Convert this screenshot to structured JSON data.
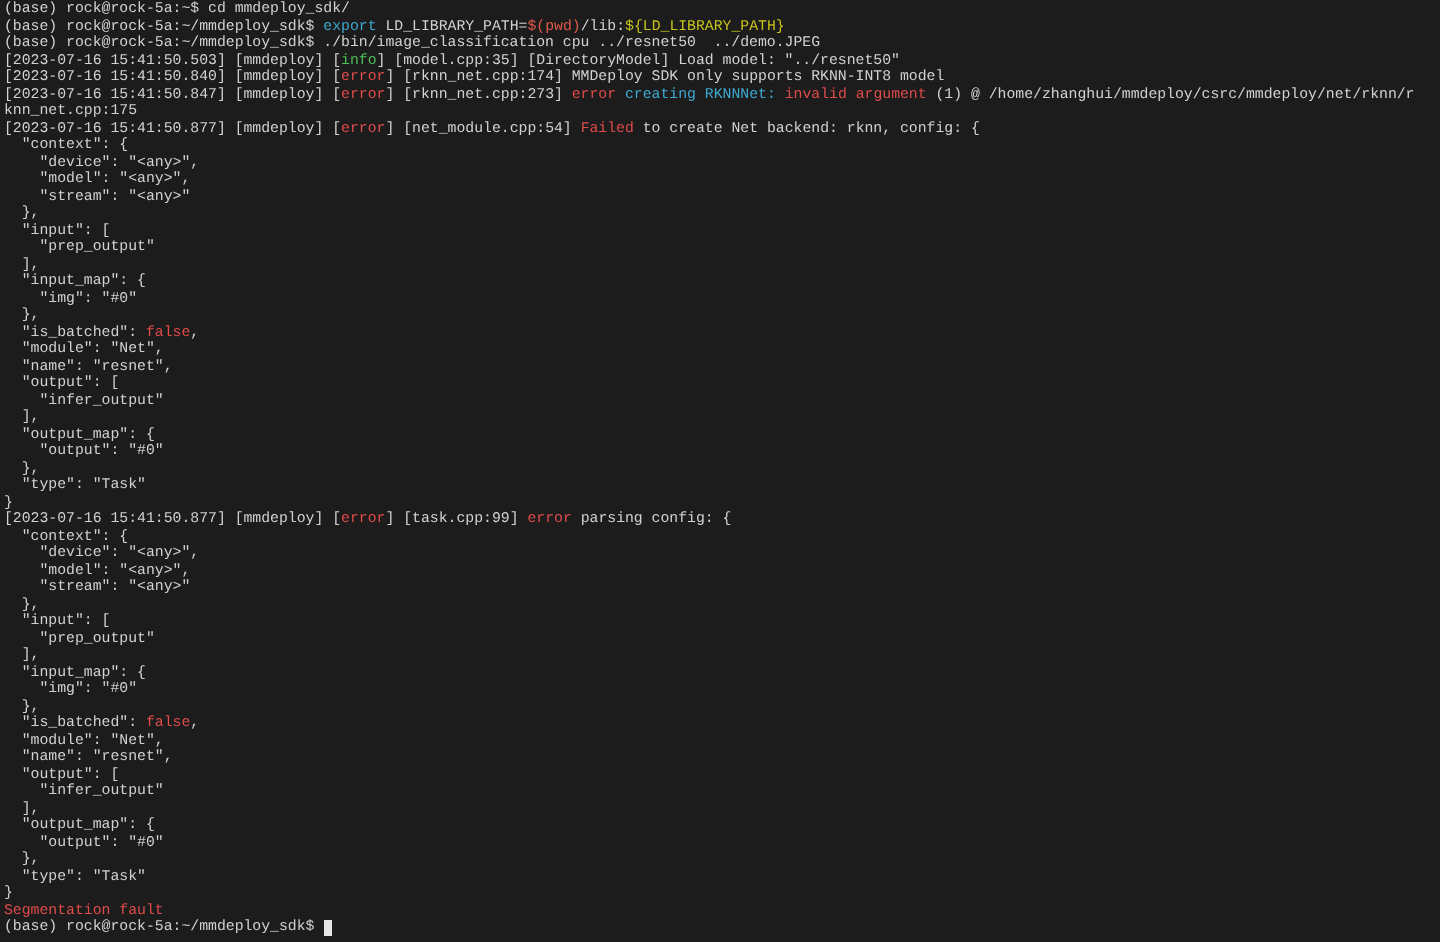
{
  "terminal": {
    "lines": [
      {
        "segments": [
          {
            "kind": "text",
            "text": "(base) rock@rock-5a:~$ cd mmdeploy_sdk/"
          }
        ]
      },
      {
        "segments": [
          {
            "kind": "text",
            "text": "(base) rock@rock-5a:~/mmdeploy_sdk$ "
          },
          {
            "kind": "command",
            "text": "export"
          },
          {
            "kind": "text",
            "text": " LD_LIBRARY_PATH="
          },
          {
            "kind": "substitution",
            "text": "$(pwd)"
          },
          {
            "kind": "text",
            "text": "/lib:"
          },
          {
            "kind": "variable",
            "text": "${LD_LIBRARY_PATH}"
          }
        ]
      },
      {
        "segments": [
          {
            "kind": "text",
            "text": "(base) rock@rock-5a:~/mmdeploy_sdk$ ./bin/image_classification cpu ../resnet50  ../demo.JPEG"
          }
        ]
      },
      {
        "segments": [
          {
            "kind": "text",
            "text": "[2023-07-16 15:41:50.503] [mmdeploy] ["
          },
          {
            "kind": "info",
            "text": "info"
          },
          {
            "kind": "text",
            "text": "] [model.cpp:35] [DirectoryModel] Load model: \"../resnet50\""
          }
        ]
      },
      {
        "segments": [
          {
            "kind": "text",
            "text": "[2023-07-16 15:41:50.840] [mmdeploy] ["
          },
          {
            "kind": "error",
            "text": "error"
          },
          {
            "kind": "text",
            "text": "] [rknn_net.cpp:174] MMDeploy SDK only supports RKNN-INT8 model"
          }
        ]
      },
      {
        "segments": [
          {
            "kind": "text",
            "text": "[2023-07-16 15:41:50.847] [mmdeploy] ["
          },
          {
            "kind": "error",
            "text": "error"
          },
          {
            "kind": "text",
            "text": "] [rknn_net.cpp:273] "
          },
          {
            "kind": "error",
            "text": "error"
          },
          {
            "kind": "command",
            "text": " creating RKNNNet:"
          },
          {
            "kind": "error",
            "text": " invalid argument"
          },
          {
            "kind": "text",
            "text": " (1) @ /home/zhanghui/mmdeploy/csrc/mmdeploy/net/rknn/r"
          }
        ]
      },
      {
        "segments": [
          {
            "kind": "text",
            "text": "knn_net.cpp:175"
          }
        ]
      },
      {
        "segments": [
          {
            "kind": "text",
            "text": "[2023-07-16 15:41:50.877] [mmdeploy] ["
          },
          {
            "kind": "error",
            "text": "error"
          },
          {
            "kind": "text",
            "text": "] [net_module.cpp:54] "
          },
          {
            "kind": "error",
            "text": "Failed"
          },
          {
            "kind": "text",
            "text": " to create Net backend: rknn, config: {"
          }
        ]
      },
      {
        "segments": [
          {
            "kind": "text",
            "text": "  \"context\": {"
          }
        ]
      },
      {
        "segments": [
          {
            "kind": "text",
            "text": "    \"device\": \"<any>\","
          }
        ]
      },
      {
        "segments": [
          {
            "kind": "text",
            "text": "    \"model\": \"<any>\","
          }
        ]
      },
      {
        "segments": [
          {
            "kind": "text",
            "text": "    \"stream\": \"<any>\""
          }
        ]
      },
      {
        "segments": [
          {
            "kind": "text",
            "text": "  },"
          }
        ]
      },
      {
        "segments": [
          {
            "kind": "text",
            "text": "  \"input\": ["
          }
        ]
      },
      {
        "segments": [
          {
            "kind": "text",
            "text": "    \"prep_output\""
          }
        ]
      },
      {
        "segments": [
          {
            "kind": "text",
            "text": "  ],"
          }
        ]
      },
      {
        "segments": [
          {
            "kind": "text",
            "text": "  \"input_map\": {"
          }
        ]
      },
      {
        "segments": [
          {
            "kind": "text",
            "text": "    \"img\": \"#0\""
          }
        ]
      },
      {
        "segments": [
          {
            "kind": "text",
            "text": "  },"
          }
        ]
      },
      {
        "segments": [
          {
            "kind": "text",
            "text": "  \"is_batched\": "
          },
          {
            "kind": "error",
            "text": "false"
          },
          {
            "kind": "text",
            "text": ","
          }
        ]
      },
      {
        "segments": [
          {
            "kind": "text",
            "text": "  \"module\": \"Net\","
          }
        ]
      },
      {
        "segments": [
          {
            "kind": "text",
            "text": "  \"name\": \"resnet\","
          }
        ]
      },
      {
        "segments": [
          {
            "kind": "text",
            "text": "  \"output\": ["
          }
        ]
      },
      {
        "segments": [
          {
            "kind": "text",
            "text": "    \"infer_output\""
          }
        ]
      },
      {
        "segments": [
          {
            "kind": "text",
            "text": "  ],"
          }
        ]
      },
      {
        "segments": [
          {
            "kind": "text",
            "text": "  \"output_map\": {"
          }
        ]
      },
      {
        "segments": [
          {
            "kind": "text",
            "text": "    \"output\": \"#0\""
          }
        ]
      },
      {
        "segments": [
          {
            "kind": "text",
            "text": "  },"
          }
        ]
      },
      {
        "segments": [
          {
            "kind": "text",
            "text": "  \"type\": \"Task\""
          }
        ]
      },
      {
        "segments": [
          {
            "kind": "text",
            "text": "}"
          }
        ]
      },
      {
        "segments": [
          {
            "kind": "text",
            "text": "[2023-07-16 15:41:50.877] [mmdeploy] ["
          },
          {
            "kind": "error",
            "text": "error"
          },
          {
            "kind": "text",
            "text": "] [task.cpp:99] "
          },
          {
            "kind": "error",
            "text": "error"
          },
          {
            "kind": "text",
            "text": " parsing config: {"
          }
        ]
      },
      {
        "segments": [
          {
            "kind": "text",
            "text": "  \"context\": {"
          }
        ]
      },
      {
        "segments": [
          {
            "kind": "text",
            "text": "    \"device\": \"<any>\","
          }
        ]
      },
      {
        "segments": [
          {
            "kind": "text",
            "text": "    \"model\": \"<any>\","
          }
        ]
      },
      {
        "segments": [
          {
            "kind": "text",
            "text": "    \"stream\": \"<any>\""
          }
        ]
      },
      {
        "segments": [
          {
            "kind": "text",
            "text": "  },"
          }
        ]
      },
      {
        "segments": [
          {
            "kind": "text",
            "text": "  \"input\": ["
          }
        ]
      },
      {
        "segments": [
          {
            "kind": "text",
            "text": "    \"prep_output\""
          }
        ]
      },
      {
        "segments": [
          {
            "kind": "text",
            "text": "  ],"
          }
        ]
      },
      {
        "segments": [
          {
            "kind": "text",
            "text": "  \"input_map\": {"
          }
        ]
      },
      {
        "segments": [
          {
            "kind": "text",
            "text": "    \"img\": \"#0\""
          }
        ]
      },
      {
        "segments": [
          {
            "kind": "text",
            "text": "  },"
          }
        ]
      },
      {
        "segments": [
          {
            "kind": "text",
            "text": "  \"is_batched\": "
          },
          {
            "kind": "error",
            "text": "false"
          },
          {
            "kind": "text",
            "text": ","
          }
        ]
      },
      {
        "segments": [
          {
            "kind": "text",
            "text": "  \"module\": \"Net\","
          }
        ]
      },
      {
        "segments": [
          {
            "kind": "text",
            "text": "  \"name\": \"resnet\","
          }
        ]
      },
      {
        "segments": [
          {
            "kind": "text",
            "text": "  \"output\": ["
          }
        ]
      },
      {
        "segments": [
          {
            "kind": "text",
            "text": "    \"infer_output\""
          }
        ]
      },
      {
        "segments": [
          {
            "kind": "text",
            "text": "  ],"
          }
        ]
      },
      {
        "segments": [
          {
            "kind": "text",
            "text": "  \"output_map\": {"
          }
        ]
      },
      {
        "segments": [
          {
            "kind": "text",
            "text": "    \"output\": \"#0\""
          }
        ]
      },
      {
        "segments": [
          {
            "kind": "text",
            "text": "  },"
          }
        ]
      },
      {
        "segments": [
          {
            "kind": "text",
            "text": "  \"type\": \"Task\""
          }
        ]
      },
      {
        "segments": [
          {
            "kind": "text",
            "text": "}"
          }
        ]
      },
      {
        "segments": [
          {
            "kind": "error",
            "text": "Segmentation fault"
          }
        ]
      },
      {
        "segments": [
          {
            "kind": "text",
            "text": "(base) rock@rock-5a:~/mmdeploy_sdk$ "
          }
        ],
        "cursor": true
      }
    ]
  }
}
